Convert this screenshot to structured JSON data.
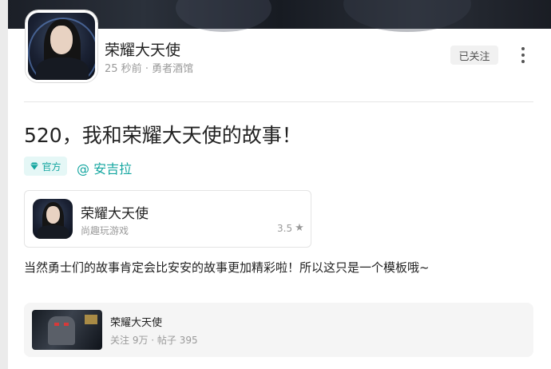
{
  "author": {
    "name": "荣耀大天使",
    "time": "25 秒前",
    "forum": "· 勇者酒馆",
    "follow_label": "已关注"
  },
  "post": {
    "title": "520，我和荣耀大天使的故事！",
    "badge_label": "官方",
    "mention": "@ 安吉拉",
    "body": "当然勇士们的故事肯定会比安安的故事更加精彩啦！所以这只是一个模板哦~"
  },
  "game_card": {
    "name": "荣耀大天使",
    "developer": "尚趣玩游戏",
    "rating": "3.5",
    "star": "★"
  },
  "forum_card": {
    "name": "荣耀大天使",
    "stats": "关注 9万 · 帖子 395"
  },
  "colors": {
    "accent": "#14a6a0",
    "muted": "#9a9a9a",
    "text": "#222222"
  },
  "icons": [
    "more-vertical-icon",
    "diamond-icon",
    "star-icon"
  ]
}
